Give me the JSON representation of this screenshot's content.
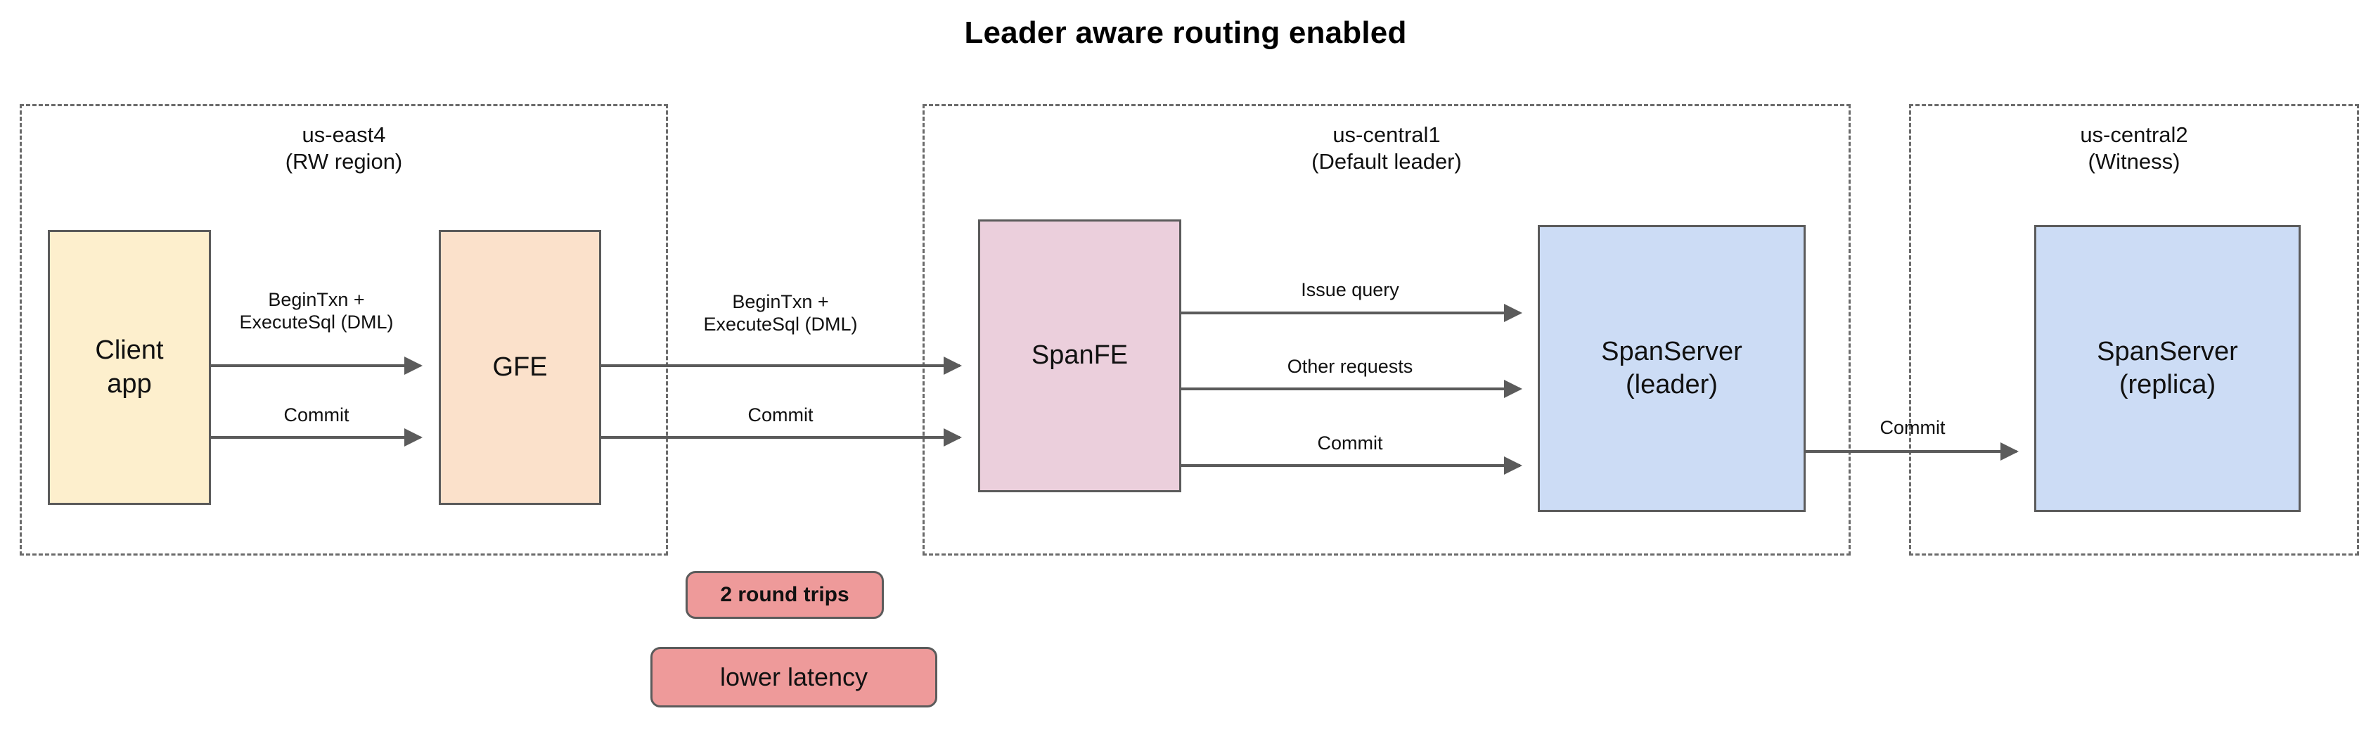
{
  "title": "Leader aware routing enabled",
  "regions": [
    {
      "id": "us-east4",
      "label": "us-east4\n(RW region)"
    },
    {
      "id": "us-central1",
      "label": "us-central1\n(Default leader)"
    },
    {
      "id": "us-central2",
      "label": "us-central2\n(Witness)"
    }
  ],
  "nodes": [
    {
      "id": "client-app",
      "label": "Client\napp",
      "color": "#FDEFCD"
    },
    {
      "id": "gfe",
      "label": "GFE",
      "color": "#FBE1CB"
    },
    {
      "id": "spanfe",
      "label": "SpanFE",
      "color": "#EBCFDC"
    },
    {
      "id": "spanserver-leader",
      "label": "SpanServer\n(leader)",
      "color": "#CCDCF5"
    },
    {
      "id": "spanserver-replica",
      "label": "SpanServer\n(replica)",
      "color": "#CCDCF5"
    }
  ],
  "arrows": [
    {
      "id": "client-to-gfe-begin",
      "label": "BeginTxn +\nExecuteSql (DML)"
    },
    {
      "id": "client-to-gfe-commit",
      "label": "Commit"
    },
    {
      "id": "gfe-to-spanfe-begin",
      "label": "BeginTxn +\nExecuteSql (DML)"
    },
    {
      "id": "gfe-to-spanfe-commit",
      "label": "Commit"
    },
    {
      "id": "spanfe-issue-query",
      "label": "Issue query"
    },
    {
      "id": "spanfe-other-requests",
      "label": "Other requests"
    },
    {
      "id": "spanfe-commit",
      "label": "Commit"
    },
    {
      "id": "leader-to-replica",
      "label": "Commit"
    }
  ],
  "badges": [
    {
      "id": "round-trips",
      "label": "2 round trips",
      "color": "#EE9A9A"
    },
    {
      "id": "latency",
      "label": "lower latency",
      "color": "#EE9A9A"
    }
  ],
  "colors": {
    "stroke": "#5b5b5b",
    "region_border": "#6b6b6b",
    "background": "#ffffff",
    "badge": "#EE9A9A"
  }
}
